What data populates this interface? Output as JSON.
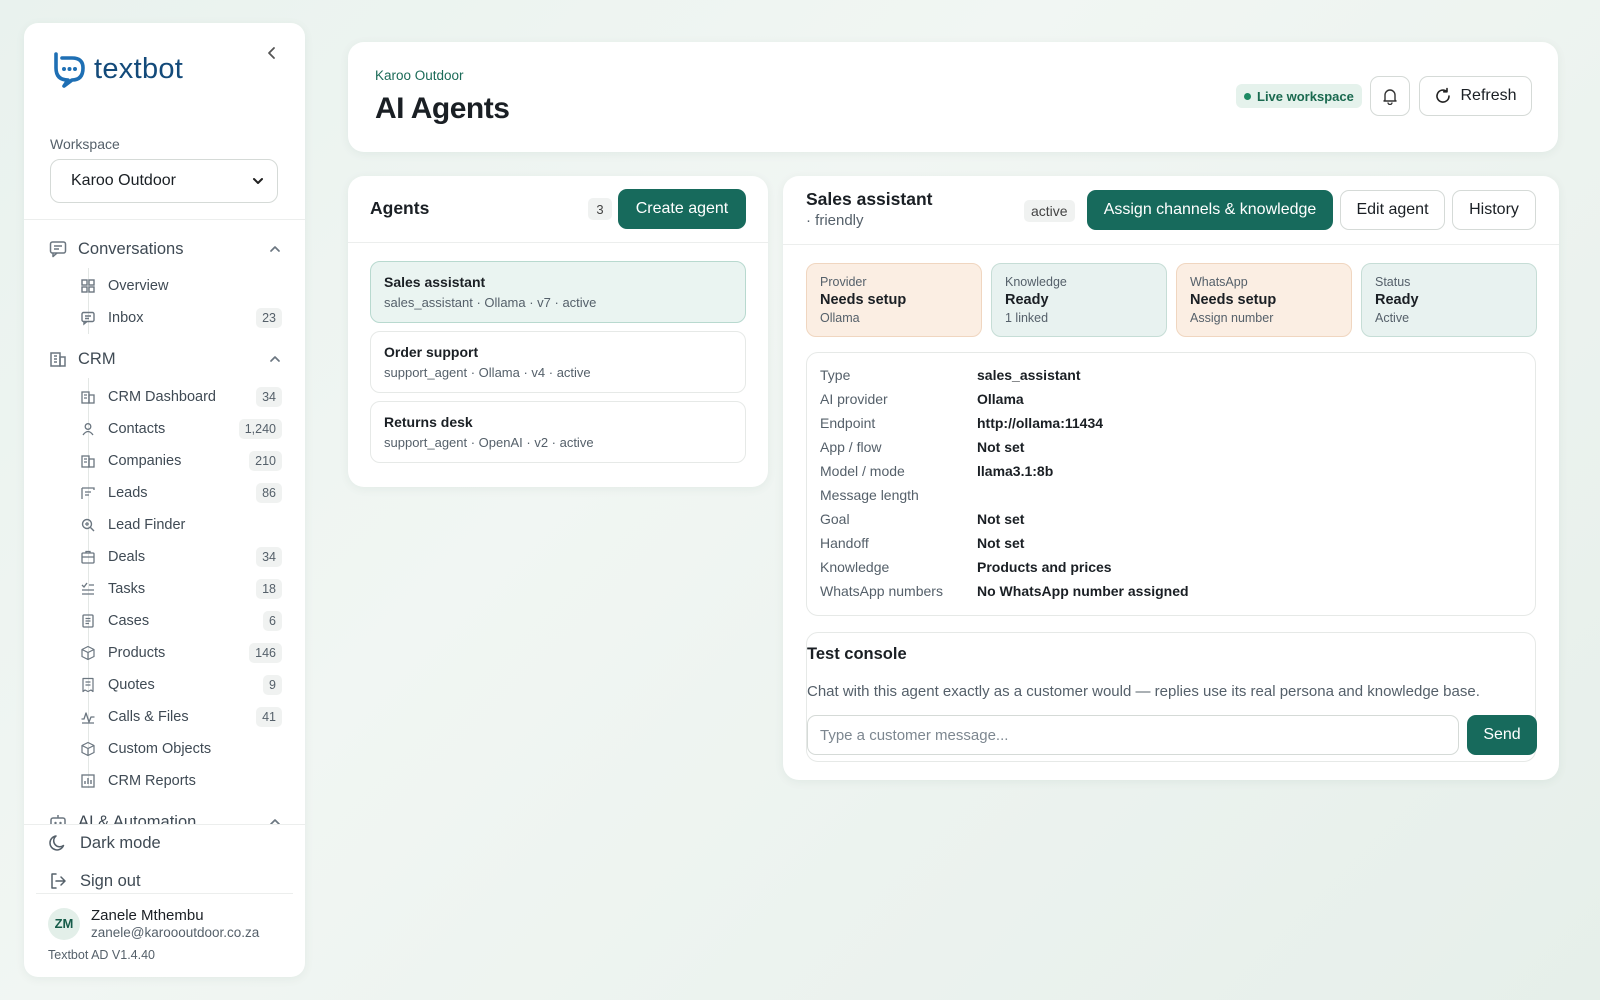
{
  "sidebar": {
    "logo_text": "textbot",
    "workspace_label": "Workspace",
    "workspace_value": "Karoo Outdoor",
    "groups": [
      {
        "label": "Conversations",
        "icon": "chat-icon"
      },
      {
        "label": "CRM",
        "icon": "building-icon"
      },
      {
        "label": "AI & Automation",
        "icon": "robot-icon"
      }
    ],
    "conversation_items": [
      {
        "label": "Overview",
        "badge": "",
        "icon": "grid-icon"
      },
      {
        "label": "Inbox",
        "badge": "23",
        "icon": "inbox-icon"
      }
    ],
    "crm_items": [
      {
        "label": "CRM Dashboard",
        "badge": "34",
        "icon": "building-icon"
      },
      {
        "label": "Contacts",
        "badge": "1,240",
        "icon": "user-icon"
      },
      {
        "label": "Companies",
        "badge": "210",
        "icon": "building-icon"
      },
      {
        "label": "Leads",
        "badge": "86",
        "icon": "funnel-icon"
      },
      {
        "label": "Lead Finder",
        "badge": "",
        "icon": "search-icon"
      },
      {
        "label": "Deals",
        "badge": "34",
        "icon": "briefcase-icon"
      },
      {
        "label": "Tasks",
        "badge": "18",
        "icon": "checklist-icon"
      },
      {
        "label": "Cases",
        "badge": "6",
        "icon": "document-icon"
      },
      {
        "label": "Products",
        "badge": "146",
        "icon": "box-icon"
      },
      {
        "label": "Quotes",
        "badge": "9",
        "icon": "receipt-icon"
      },
      {
        "label": "Calls & Files",
        "badge": "41",
        "icon": "pulse-icon"
      },
      {
        "label": "Custom Objects",
        "badge": "",
        "icon": "cube-icon"
      },
      {
        "label": "CRM Reports",
        "badge": "",
        "icon": "bar-chart-icon"
      }
    ],
    "dark_mode_label": "Dark mode",
    "sign_out_label": "Sign out",
    "user": {
      "initials": "ZM",
      "name": "Zanele Mthembu",
      "email": "zanele@karoooutdoor.co.za"
    },
    "version": "Textbot AD V1.4.40"
  },
  "header": {
    "breadcrumb": "Karoo Outdoor",
    "title": "AI Agents",
    "live_badge": "Live workspace",
    "refresh_label": "Refresh"
  },
  "agents": {
    "title": "Agents",
    "count": "3",
    "create_label": "Create agent",
    "list": [
      {
        "name": "Sales assistant",
        "meta": "sales_assistant · Ollama · v7 · active",
        "selected": true
      },
      {
        "name": "Order support",
        "meta": "support_agent · Ollama · v4 · active",
        "selected": false
      },
      {
        "name": "Returns desk",
        "meta": "support_agent · OpenAI · v2 · active",
        "selected": false
      }
    ]
  },
  "detail": {
    "name": "Sales assistant",
    "persona": "· friendly",
    "state": "active",
    "assign_label": "Assign channels & knowledge",
    "edit_label": "Edit agent",
    "history_label": "History",
    "status_cards": [
      {
        "label": "Provider",
        "value": "Needs setup",
        "sub": "Ollama",
        "tone": "warn"
      },
      {
        "label": "Knowledge",
        "value": "Ready",
        "sub": "1 linked",
        "tone": "ok"
      },
      {
        "label": "WhatsApp",
        "value": "Needs setup",
        "sub": "Assign number",
        "tone": "warn"
      },
      {
        "label": "Status",
        "value": "Ready",
        "sub": "Active",
        "tone": "ok"
      }
    ],
    "properties": [
      {
        "key": "Type",
        "value": "sales_assistant"
      },
      {
        "key": "AI provider",
        "value": "Ollama"
      },
      {
        "key": "Endpoint",
        "value": "http://ollama:11434"
      },
      {
        "key": "App / flow",
        "value": "Not set"
      },
      {
        "key": "Model / mode",
        "value": "llama3.1:8b"
      },
      {
        "key": "Message length",
        "value": ""
      },
      {
        "key": "Goal",
        "value": "Not set"
      },
      {
        "key": "Handoff",
        "value": "Not set"
      },
      {
        "key": "Knowledge",
        "value": "Products and prices"
      },
      {
        "key": "WhatsApp numbers",
        "value": "No WhatsApp number assigned"
      }
    ],
    "console": {
      "title": "Test console",
      "description": "Chat with this agent exactly as a customer would — replies use its real persona and knowledge base.",
      "placeholder": "Type a customer message...",
      "send_label": "Send"
    }
  },
  "colors": {
    "accent": "#176a5c",
    "warn_bg": "#fbeee3",
    "ok_bg": "#e8f2f0"
  }
}
